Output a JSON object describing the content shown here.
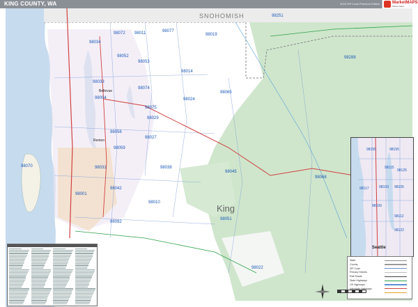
{
  "header": {
    "title": "KING COUNTY, WA",
    "edition": "2023 ZIP Code Premium Edition",
    "logo_text": "MarketMAPS",
    "logo_sub": "Market Maps"
  },
  "map": {
    "county_label": "King",
    "neighbor_label": "SNOHOMISH",
    "zip_labels": [
      "98251",
      "98072",
      "98077",
      "98011",
      "98019",
      "98034",
      "98052",
      "98053",
      "98014",
      "98288",
      "98033",
      "98004",
      "98074",
      "98075",
      "98024",
      "98065",
      "98029",
      "98027",
      "98056",
      "98059",
      "98038",
      "98045",
      "98070",
      "98031",
      "98042",
      "98010",
      "98001",
      "98092",
      "98022",
      "98051",
      "98068",
      "98056",
      "98155",
      "98115",
      "98125",
      "98117",
      "98103",
      "98112",
      "98122",
      "98148",
      "98133",
      "98105",
      "98102",
      "98109",
      "98144"
    ],
    "inset_city": "Seattle",
    "city_samples": [
      "Bellevue",
      "Renton",
      "Seattle"
    ]
  },
  "legend": {
    "items": [
      {
        "label": "State",
        "color": "#888888"
      },
      {
        "label": "County",
        "color": "#999999"
      },
      {
        "label": "ZIP Code",
        "color": "#6a8fc7"
      },
      {
        "label": "Primary Streets",
        "color": "#bdbdbd"
      },
      {
        "label": "Rail Roads",
        "color": "#444444"
      },
      {
        "label": "State Highways",
        "color": "#2aa14a"
      },
      {
        "label": "US Highways",
        "color": "#5b8ed8"
      },
      {
        "label": "Interstate Highways",
        "color": "#d04040"
      },
      {
        "label": "Toll Roads",
        "color": "#e8a020"
      }
    ],
    "city_label": "City"
  },
  "colors": {
    "water": "#c7dbee",
    "land": "#ffffff",
    "forest": "#c9e2c7",
    "urban": "#e9e2f0",
    "boundary": "#7a9ad6"
  }
}
